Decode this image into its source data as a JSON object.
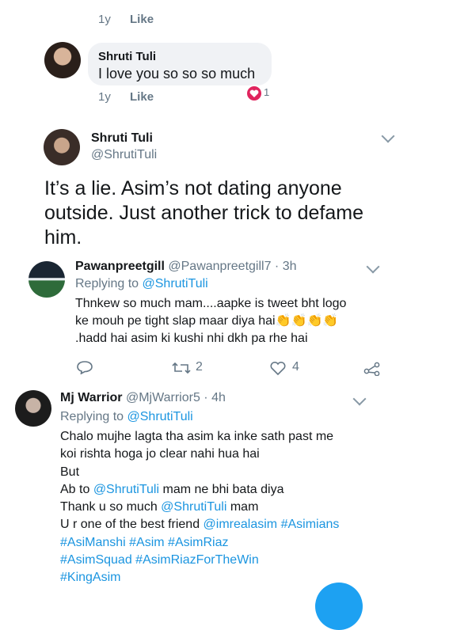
{
  "reply_top": {
    "time": "1y",
    "like": "Like"
  },
  "comment": {
    "name": "Shruti Tuli",
    "text": "I love you so so so much",
    "time": "1y",
    "like": "Like",
    "reaction_count": "1"
  },
  "main_tweet": {
    "name": "Shruti Tuli",
    "handle": "@ShrutiTuli",
    "lines": [
      "It’s a lie. Asim’s not dating anyone",
      "outside. Just another trick to defame",
      "him."
    ]
  },
  "reply1": {
    "name": "Pawanpreetgill",
    "handle": "@Pawanpreetgill7 · 3h",
    "replying_prefix": "Replying to ",
    "replying_to": "@ShrutiTuli",
    "line1": "Thnkew so much mam....aapke is tweet bht logo",
    "line2": "ke mouh pe tight slap maar diya hai",
    "line2_emoji": "👏👏👏👏",
    "line3": ".hadd hai asim ki kushi nhi dkh pa rhe hai",
    "retweets": "2",
    "likes": "4"
  },
  "reply2": {
    "name": "Mj Warrior",
    "handle": "@MjWarrior5 · 4h",
    "replying_prefix": "Replying to ",
    "replying_to": "@ShrutiTuli",
    "line1": "Chalo mujhe lagta tha asim ka inke sath past me",
    "line2": "koi rishta hoga jo clear nahi hua hai",
    "line3": "But",
    "line4_a": "Ab to ",
    "line4_b": "@ShrutiTuli",
    "line4_c": " mam ne bhi bata diya",
    "line5_a": "Thank u so much ",
    "line5_b": "@ShrutiTuli",
    "line5_c": " mam",
    "line6_a": "U r one of the best friend ",
    "line6_b": "@imrealasim #Asimians",
    "line7": "#AsiManshi #Asim #AsimRiaz",
    "line8": "#AsimSquad #AsimRiazForTheWin",
    "line9": "#KingAsim"
  },
  "colors": {
    "link": "#1b95e0",
    "muted": "#657786",
    "reaction": "#e0245e"
  }
}
